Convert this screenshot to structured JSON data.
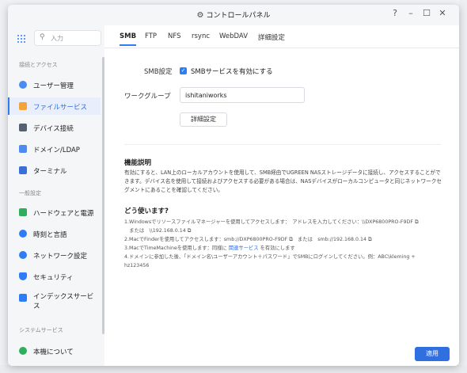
{
  "window": {
    "title": "コントロールパネル",
    "controls": [
      "?",
      "–",
      "☐",
      "✕"
    ]
  },
  "sidebar": {
    "search_placeholder": "入力",
    "sections": [
      {
        "label": "接続とアクセス"
      },
      {
        "label": "一般設定"
      },
      {
        "label": "システムサービス"
      }
    ],
    "items": [
      {
        "label": "ユーザー管理",
        "color": "#4a8cf0"
      },
      {
        "label": "ファイルサービス",
        "color": "#f2a43a",
        "active": true
      },
      {
        "label": "デバイス接続",
        "color": "#556070"
      },
      {
        "label": "ドメイン/LDAP",
        "color": "#4a8cf0"
      },
      {
        "label": "ターミナル",
        "color": "#3a6fd8"
      },
      {
        "label": "ハードウェアと電源",
        "color": "#2fae5c"
      },
      {
        "label": "時刻と言語",
        "color": "#2f7df6"
      },
      {
        "label": "ネットワーク設定",
        "color": "#2f7df6"
      },
      {
        "label": "セキュリティ",
        "color": "#2f7df6"
      },
      {
        "label": "インデックスサービス",
        "color": "#2f7df6"
      },
      {
        "label": "本機について",
        "color": "#2fae5c"
      }
    ]
  },
  "tabs": [
    {
      "label": "SMB",
      "active": true
    },
    {
      "label": "FTP"
    },
    {
      "label": "NFS"
    },
    {
      "label": "rsync"
    },
    {
      "label": "WebDAV"
    },
    {
      "label": "詳細設定"
    }
  ],
  "smb": {
    "setting_label": "SMB設定",
    "enable_label": "SMBサービスを有効にする",
    "enabled": true,
    "workgroup_label": "ワークグループ",
    "workgroup_value": "ishitaniworks",
    "advanced_button": "詳細設定"
  },
  "help": {
    "title": "機能説明",
    "description": "有効にすると、LAN上のローカルアカウントを使用して、SMB経由でUGREEN NASストレージデータに接続し、アクセスすることができます。デバイス名を使用して接続およびアクセスする必要がある場合は、NASデバイスがローカルコンピュータと同じネットワークセグメントにあることを確認してください。",
    "howto_title": "どう使います?",
    "steps": [
      {
        "text": "1.Windowsでリソースファイルマネージャーを使用してアクセスします：　アドレスを入力してください：\\\\DXP6800PRO-F9DF ⧉"
      },
      {
        "text": "　または　\\\\192.168.0.14 ⧉"
      },
      {
        "text": "2.MacでFinderを使用してアクセスします：smb://DXP6800PRO-F9DF ⧉　または　smb://192.168.0.14 ⧉"
      },
      {
        "pre": "3.MacでTimeMachineを使用します：同様に",
        "link": "関連サービス",
        "post": "を有効にします"
      },
      {
        "text": "4.ドメインに参加した後、「ドメイン名\\ユーザーアカウント＋パスワード」でSMBにログインしてください。例：ABC\\kleming +"
      },
      {
        "text": "hz123456"
      }
    ]
  },
  "footer": {
    "apply_button": "適用"
  }
}
